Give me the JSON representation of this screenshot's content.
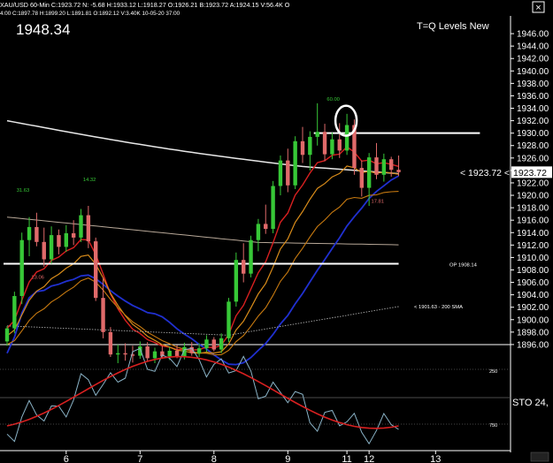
{
  "header": {
    "line1": "XAU/USD 60-Min  C:1923.72  N: -5.68  H:1933.12  L:1918.27  O:1926.21  B:1923.72  A:1924.15  V:56.4K  O",
    "line2": "4:00  C:1897.78  H:1899.20  L:1891.81  O:1892.12  V:3.40K  10-05-20  37:00"
  },
  "price_display": "1948.34",
  "chart_title": "T=Q Levels New",
  "close_icon_char": "×",
  "colors": {
    "background": "#000000",
    "up_candle": "#37c837",
    "down_candle": "#e06a6a",
    "ma_red": "#d82020",
    "ma_orange": "#d98c1a",
    "ma_orange2": "#c87a10",
    "ma_blue": "#2030d0",
    "ma_tan": "#b8a898",
    "ma_white": "#e8e8e8",
    "stoch": "#8bb4c8",
    "level_line": "#ffffff",
    "axis_text": "#ffffff"
  },
  "price_axis": {
    "min": 1894,
    "max": 1948,
    "ticks": [
      "1946.00",
      "1944.00",
      "1942.00",
      "1940.00",
      "1938.00",
      "1936.00",
      "1934.00",
      "1932.00",
      "1930.00",
      "1928.00",
      "1926.00",
      "1924.00",
      "1922.00",
      "1920.00",
      "1918.00",
      "1916.00",
      "1914.00",
      "1912.00",
      "1910.00",
      "1908.00",
      "1906.00",
      "1904.00",
      "1902.00",
      "1900.00",
      "1898.00",
      "1896.00"
    ],
    "last_price": "1923.72",
    "last_price_label": "< 1923.72 <"
  },
  "date_axis": {
    "labels": [
      {
        "text": "6",
        "bar": 8
      },
      {
        "text": "7",
        "bar": 18
      },
      {
        "text": "8",
        "bar": 28
      },
      {
        "text": "9",
        "bar": 38
      },
      {
        "text": "11",
        "bar": 46
      },
      {
        "text": "12",
        "bar": 49
      },
      {
        "text": "13",
        "bar": 58
      }
    ]
  },
  "annotations": [
    {
      "id": "swing-high-label",
      "text": "60.00",
      "bar": 44,
      "price": 1935.2,
      "color": "#37c837"
    },
    {
      "id": "swing-left-label",
      "text": "31.63",
      "bar": 2,
      "price": 1920.6,
      "color": "#37c837"
    },
    {
      "id": "swing-mid-label",
      "text": "14.32",
      "bar": 11,
      "price": 1922.3,
      "color": "#37c837"
    },
    {
      "id": "swing-low-label",
      "text": "17.81",
      "bar": 50,
      "price": 1918.8,
      "color": "#e06a6a"
    },
    {
      "id": "swing-left-low-label",
      "text": "13.06",
      "bar": 4,
      "price": 1906.6,
      "color": "#e06a6a"
    }
  ],
  "levels": [
    {
      "id": "level-top-1930",
      "price": 1930.0,
      "from_bar": 42,
      "to_bar": 64
    },
    {
      "id": "level-1909",
      "price": 1909.0,
      "from_bar": 0,
      "to_bar": 53
    }
  ],
  "level_labels": [
    {
      "id": "op-level-label",
      "text": "OP 1908.14",
      "price": 1908.6
    },
    {
      "id": "sma200-label",
      "text": "< 1901.63 - 200 SMA",
      "price": 1901.8
    }
  ],
  "stoch": {
    "label": "STO 24,",
    "scale_labels": [
      {
        "text": "250",
        "value": 0.25
      },
      {
        "text": "750",
        "value": 0.75
      }
    ]
  },
  "chart_data": {
    "type": "candlestick",
    "title": "T=Q Levels New",
    "y_range": [
      1894,
      1948
    ],
    "ohlc": [
      [
        1896.5,
        1899.0,
        1895.8,
        1898.6
      ],
      [
        1898.6,
        1904.5,
        1897.8,
        1903.8
      ],
      [
        1903.8,
        1914.0,
        1902.5,
        1912.8
      ],
      [
        1912.8,
        1916.5,
        1910.2,
        1914.9
      ],
      [
        1914.9,
        1917.2,
        1911.8,
        1912.5
      ],
      [
        1912.5,
        1914.8,
        1908.5,
        1909.7
      ],
      [
        1909.7,
        1915.0,
        1909.0,
        1913.6
      ],
      [
        1913.6,
        1914.5,
        1910.5,
        1911.7
      ],
      [
        1911.7,
        1915.2,
        1910.9,
        1913.9
      ],
      [
        1913.9,
        1916.0,
        1912.0,
        1913.2
      ],
      [
        1913.2,
        1917.8,
        1912.5,
        1916.8
      ],
      [
        1916.8,
        1918.3,
        1911.5,
        1912.6
      ],
      [
        1912.6,
        1913.2,
        1903.0,
        1903.5
      ],
      [
        1903.5,
        1906.8,
        1897.0,
        1898.0
      ],
      [
        1898.0,
        1898.8,
        1894.0,
        1894.4
      ],
      [
        1894.4,
        1896.0,
        1893.0,
        1894.6
      ],
      [
        1894.6,
        1896.2,
        1893.4,
        1894.4
      ],
      [
        1894.4,
        1895.8,
        1893.1,
        1894.2
      ],
      [
        1894.2,
        1896.5,
        1893.7,
        1895.7
      ],
      [
        1895.7,
        1896.4,
        1893.2,
        1893.8
      ],
      [
        1893.8,
        1895.5,
        1893.0,
        1894.9
      ],
      [
        1894.9,
        1895.8,
        1893.7,
        1894.1
      ],
      [
        1894.1,
        1895.6,
        1893.5,
        1895.0
      ],
      [
        1895.0,
        1895.9,
        1893.8,
        1894.0
      ],
      [
        1894.0,
        1896.3,
        1893.6,
        1895.6
      ],
      [
        1895.6,
        1896.4,
        1894.2,
        1894.6
      ],
      [
        1894.6,
        1896.2,
        1894.0,
        1895.4
      ],
      [
        1895.4,
        1897.5,
        1894.8,
        1896.8
      ],
      [
        1896.8,
        1897.2,
        1894.9,
        1895.2
      ],
      [
        1895.2,
        1897.8,
        1894.6,
        1897.0
      ],
      [
        1897.0,
        1903.5,
        1896.4,
        1902.9
      ],
      [
        1902.9,
        1910.8,
        1902.1,
        1909.6
      ],
      [
        1909.6,
        1912.3,
        1906.0,
        1907.4
      ],
      [
        1907.4,
        1913.5,
        1906.8,
        1912.8
      ],
      [
        1912.8,
        1916.2,
        1911.0,
        1915.4
      ],
      [
        1915.4,
        1918.5,
        1913.8,
        1914.6
      ],
      [
        1914.6,
        1922.3,
        1913.9,
        1921.5
      ],
      [
        1921.5,
        1926.4,
        1920.0,
        1925.6
      ],
      [
        1925.6,
        1927.5,
        1920.5,
        1921.6
      ],
      [
        1921.6,
        1929.5,
        1921.0,
        1928.7
      ],
      [
        1928.7,
        1931.0,
        1925.2,
        1926.5
      ],
      [
        1926.5,
        1930.3,
        1924.0,
        1929.4
      ],
      [
        1929.4,
        1934.8,
        1928.0,
        1930.2
      ],
      [
        1930.2,
        1931.5,
        1925.5,
        1926.6
      ],
      [
        1926.6,
        1930.1,
        1925.8,
        1929.0
      ],
      [
        1929.0,
        1931.6,
        1926.0,
        1927.2
      ],
      [
        1927.2,
        1933.1,
        1926.5,
        1931.3
      ],
      [
        1931.3,
        1932.2,
        1923.3,
        1924.4
      ],
      [
        1924.4,
        1925.6,
        1919.8,
        1921.2
      ],
      [
        1921.2,
        1926.8,
        1918.3,
        1926.1
      ],
      [
        1926.1,
        1928.4,
        1922.6,
        1923.3
      ],
      [
        1923.3,
        1926.7,
        1922.2,
        1925.8
      ],
      [
        1925.8,
        1926.2,
        1923.0,
        1924.1
      ],
      [
        1924.1,
        1926.4,
        1923.1,
        1923.72
      ]
    ]
  }
}
